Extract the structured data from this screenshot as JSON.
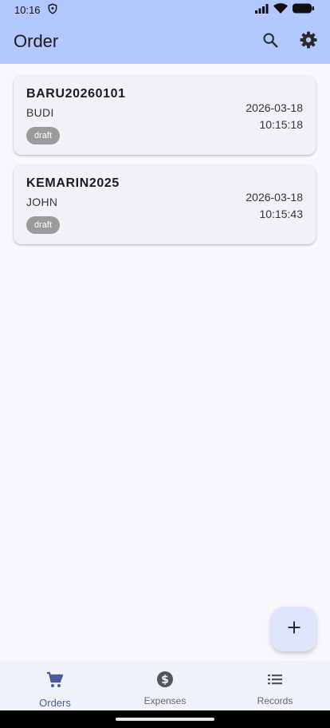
{
  "status_bar": {
    "time": "10:16",
    "icons": [
      "vpn-shield-icon",
      "signal-icon",
      "wifi-icon",
      "battery-icon"
    ]
  },
  "app_bar": {
    "title": "Order",
    "actions": [
      "search-icon",
      "settings-gear-icon"
    ]
  },
  "orders": [
    {
      "code": "BARU20260101",
      "customer": "BUDI",
      "status": "draft",
      "date": "2026-03-18",
      "time": "10:15:18"
    },
    {
      "code": "KEMARIN2025",
      "customer": "JOHN",
      "status": "draft",
      "date": "2026-03-18",
      "time": "10:15:43"
    }
  ],
  "fab": {
    "icon": "plus-icon"
  },
  "bottom_nav": {
    "items": [
      {
        "label": "Orders",
        "icon": "shopping-cart-icon",
        "active": true
      },
      {
        "label": "Expenses",
        "icon": "dollar-circle-icon",
        "active": false
      },
      {
        "label": "Records",
        "icon": "list-icon",
        "active": false
      }
    ]
  },
  "colors": {
    "app_bar": "#b3c8ff",
    "background": "#f7f7fc",
    "card": "#f2f2f6",
    "chip": "#9b9b9b",
    "fab": "#dfe6fb",
    "active_nav": "#4a5a9a"
  }
}
